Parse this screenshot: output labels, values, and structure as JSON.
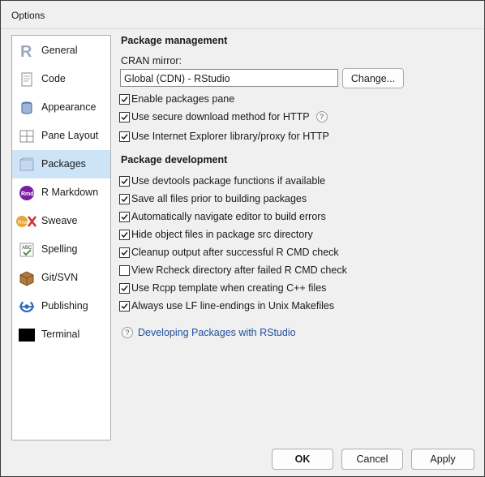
{
  "window": {
    "title": "Options"
  },
  "sidebar": {
    "items": [
      {
        "label": "General",
        "icon": "r-logo-icon"
      },
      {
        "label": "Code",
        "icon": "code-page-icon"
      },
      {
        "label": "Appearance",
        "icon": "paint-can-icon"
      },
      {
        "label": "Pane Layout",
        "icon": "pane-layout-icon"
      },
      {
        "label": "Packages",
        "icon": "packages-icon",
        "active": true
      },
      {
        "label": "R Markdown",
        "icon": "rmd-icon"
      },
      {
        "label": "Sweave",
        "icon": "sweave-icon"
      },
      {
        "label": "Spelling",
        "icon": "spelling-icon"
      },
      {
        "label": "Git/SVN",
        "icon": "git-box-icon"
      },
      {
        "label": "Publishing",
        "icon": "publishing-icon"
      },
      {
        "label": "Terminal",
        "icon": "terminal-icon"
      }
    ]
  },
  "package_management": {
    "title": "Package management",
    "cran_label": "CRAN mirror:",
    "cran_value": "Global (CDN) - RStudio",
    "change_button": "Change...",
    "options": [
      {
        "label": "Enable packages pane",
        "checked": true
      },
      {
        "label": "Use secure download method for HTTP",
        "checked": true,
        "help": "?"
      },
      {
        "label": "Use Internet Explorer library/proxy for HTTP",
        "checked": true
      }
    ]
  },
  "package_development": {
    "title": "Package development",
    "options": [
      {
        "label": "Use devtools package functions if available",
        "checked": true
      },
      {
        "label": "Save all files prior to building packages",
        "checked": true
      },
      {
        "label": "Automatically navigate editor to build errors",
        "checked": true
      },
      {
        "label": "Hide object files in package src directory",
        "checked": true
      },
      {
        "label": "Cleanup output after successful R CMD check",
        "checked": true
      },
      {
        "label": "View Rcheck directory after failed R CMD check",
        "checked": false
      },
      {
        "label": "Use Rcpp template when creating C++ files",
        "checked": true
      },
      {
        "label": "Always use LF line-endings in Unix Makefiles",
        "checked": true
      }
    ],
    "help_link": {
      "icon_text": "?",
      "label": "Developing Packages with RStudio"
    }
  },
  "footer": {
    "ok": "OK",
    "cancel": "Cancel",
    "apply": "Apply"
  },
  "colors": {
    "selected_item": "#cde4f7",
    "link": "#1f4fa0",
    "r_blue": "#2a6ebb"
  }
}
